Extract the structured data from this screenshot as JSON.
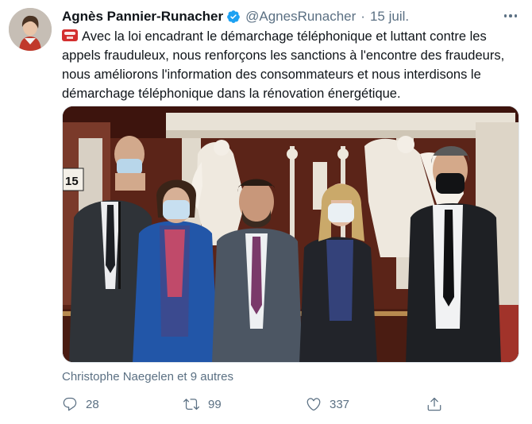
{
  "author": {
    "name": "Agnès Pannier-Runacher",
    "handle": "@AgnesRunacher",
    "date": "15 juil.",
    "verified": true,
    "accent_color": "#1da1f2"
  },
  "tweet": {
    "emoji": "telephone-emoji",
    "text": "Avec la loi encadrant le démarchage téléphonique et luttant contre les appels frauduleux, nous renforçons les sanctions à l'encontre des fraudeurs, nous améliorons l'information des consommateurs et nous interdisons le démarchage téléphonique dans la rénovation énergétique."
  },
  "likes_line": "Christophe Naegelen et 9 autres",
  "actions": {
    "reply_count": "28",
    "retweet_count": "99",
    "like_count": "337"
  },
  "photo_text": {
    "sign_number": "15"
  }
}
